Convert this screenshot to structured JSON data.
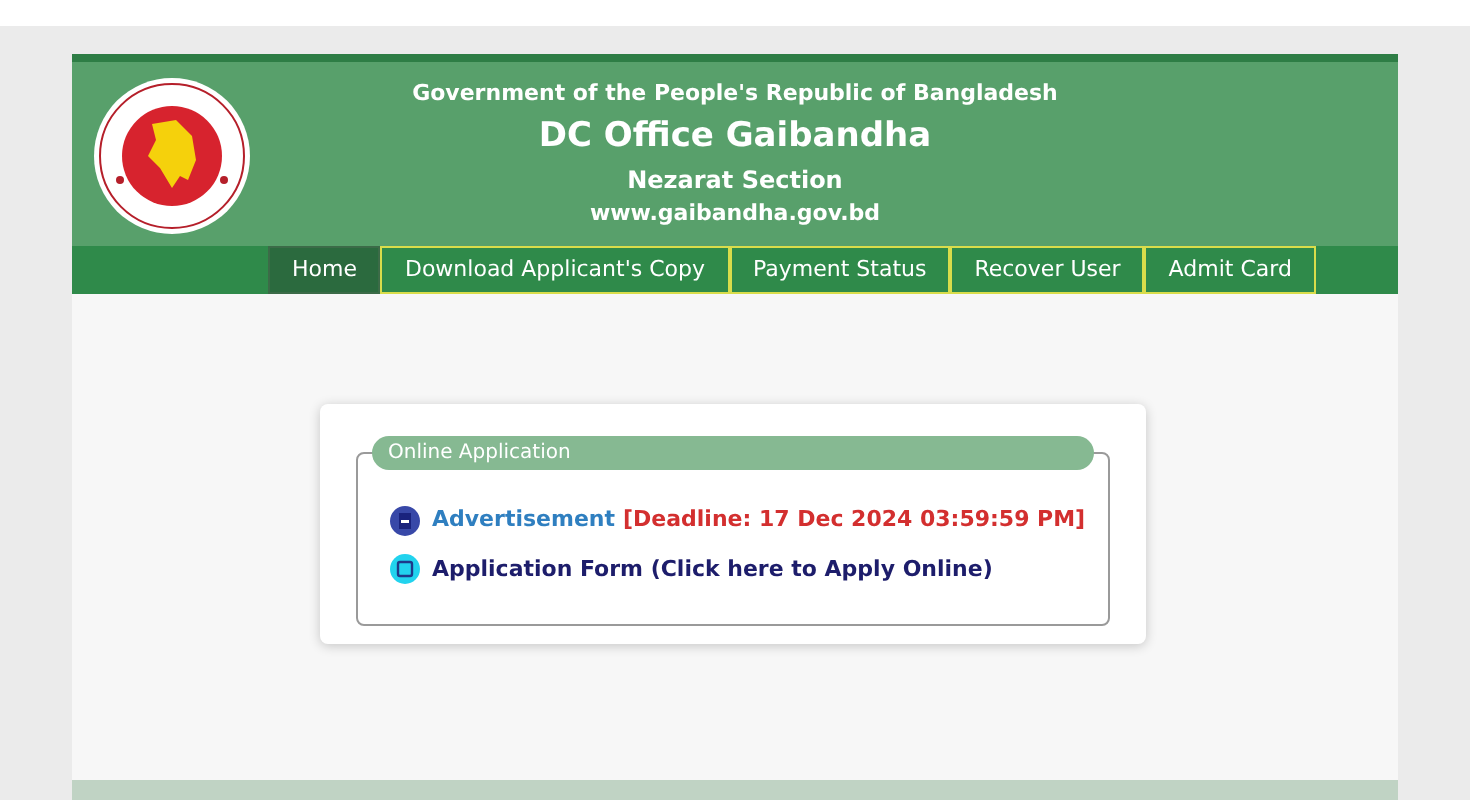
{
  "header": {
    "government": "Government of the People's Republic of Bangladesh",
    "office": "DC Office Gaibandha",
    "section": "Nezarat Section",
    "website": "www.gaibandha.gov.bd"
  },
  "nav": [
    {
      "label": "Home",
      "selected": true
    },
    {
      "label": "Download Applicant's Copy",
      "selected": false
    },
    {
      "label": "Payment Status",
      "selected": false
    },
    {
      "label": "Recover User",
      "selected": false
    },
    {
      "label": "Admit Card",
      "selected": false
    }
  ],
  "panel": {
    "title": "Online Application",
    "links": [
      {
        "kind": "pdf",
        "label": "Advertisement",
        "note": "[Deadline: 17 Dec 2024 03:59:59 PM]"
      },
      {
        "kind": "form",
        "label": "Application Form (Click here to Apply Online)"
      }
    ]
  }
}
